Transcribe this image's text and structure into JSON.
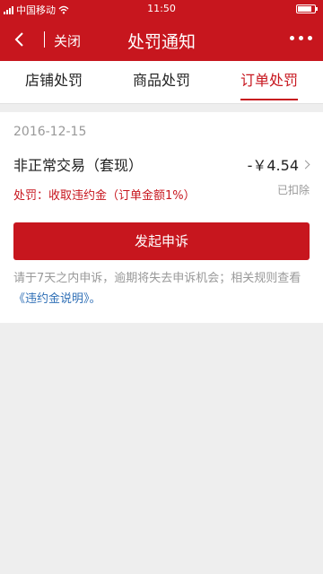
{
  "status_bar": {
    "carrier": "中国移动",
    "time": "11:50",
    "battery_level": 0.85
  },
  "nav": {
    "close_label": "关闭",
    "title": "处罚通知"
  },
  "tabs": [
    {
      "label": "店铺处罚",
      "active": false
    },
    {
      "label": "商品处罚",
      "active": false
    },
    {
      "label": "订单处罚",
      "active": true
    }
  ],
  "record": {
    "date": "2016-12-15",
    "violation": "非正常交易（套现）",
    "amount": "-￥4.54",
    "penalty": "处罚：收取违约金（订单金额1%）",
    "status": "已扣除"
  },
  "appeal_button": "发起申诉",
  "notice": {
    "text": "请于7天之内申诉，逾期将失去申诉机会；相关规则查看",
    "link": "《违约金说明》",
    "suffix": "。"
  },
  "colors": {
    "brand": "#c7161e",
    "link": "#2f6fb6",
    "muted": "#999999"
  }
}
